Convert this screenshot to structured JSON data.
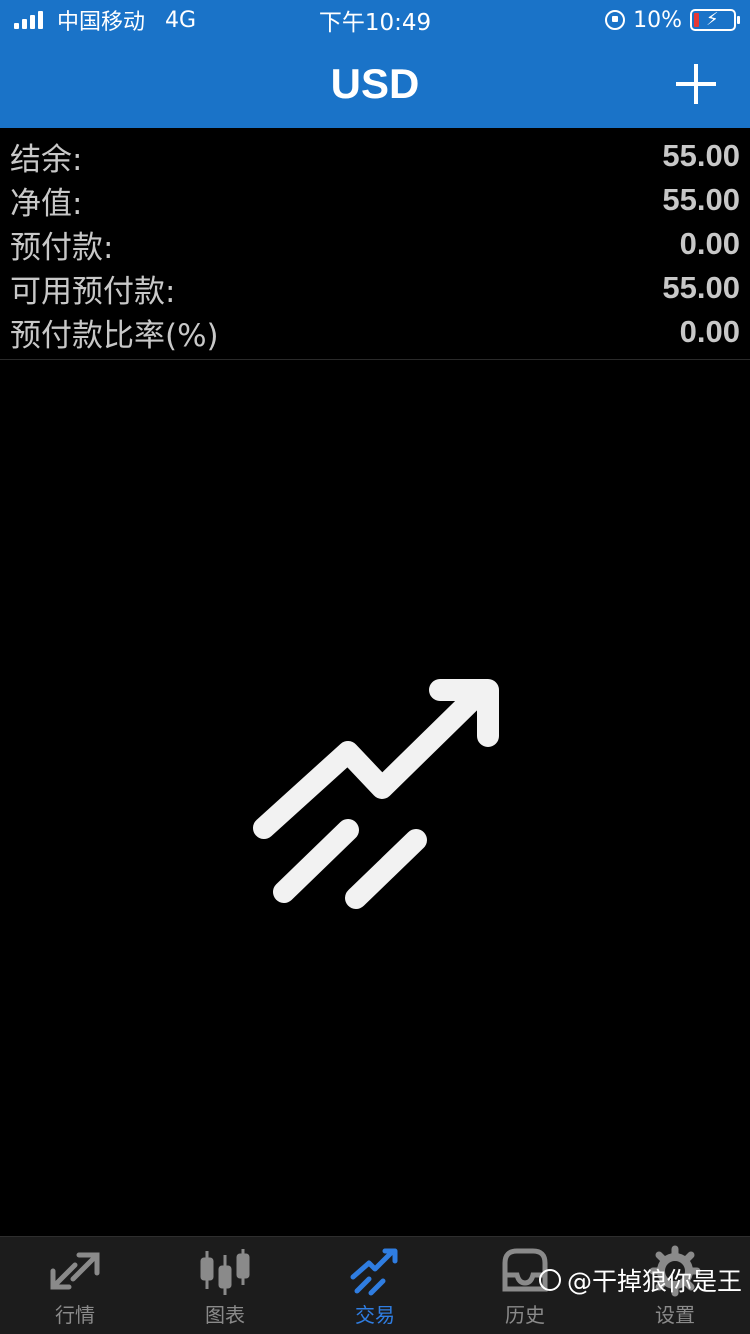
{
  "status_bar": {
    "carrier": "中国移动",
    "network": "4G",
    "time": "下午10:49",
    "battery_percent": "10%"
  },
  "header": {
    "title": "USD",
    "add_icon": "plus-icon"
  },
  "account": {
    "rows": [
      {
        "label": "结余:",
        "value": "55.00"
      },
      {
        "label": "净值:",
        "value": "55.00"
      },
      {
        "label": "预付款:",
        "value": "0.00"
      },
      {
        "label": "可用预付款:",
        "value": "55.00"
      },
      {
        "label": "预付款比率(%)",
        "value": "0.00"
      }
    ]
  },
  "empty_state": {
    "icon": "trend-up-arrow-icon"
  },
  "tabs": [
    {
      "label": "行情",
      "icon": "quotes-arrows-icon",
      "active": false
    },
    {
      "label": "图表",
      "icon": "candlestick-icon",
      "active": false
    },
    {
      "label": "交易",
      "icon": "trade-trend-icon",
      "active": true
    },
    {
      "label": "历史",
      "icon": "history-inbox-icon",
      "active": false
    },
    {
      "label": "设置",
      "icon": "gear-icon",
      "active": false
    }
  ],
  "watermark": {
    "text": "@干掉狼你是王"
  },
  "colors": {
    "header_bg": "#1a73c8",
    "background": "#000000",
    "tab_active": "#2f7de1",
    "tab_inactive": "#8a8a8a",
    "battery_low": "#e53935"
  }
}
